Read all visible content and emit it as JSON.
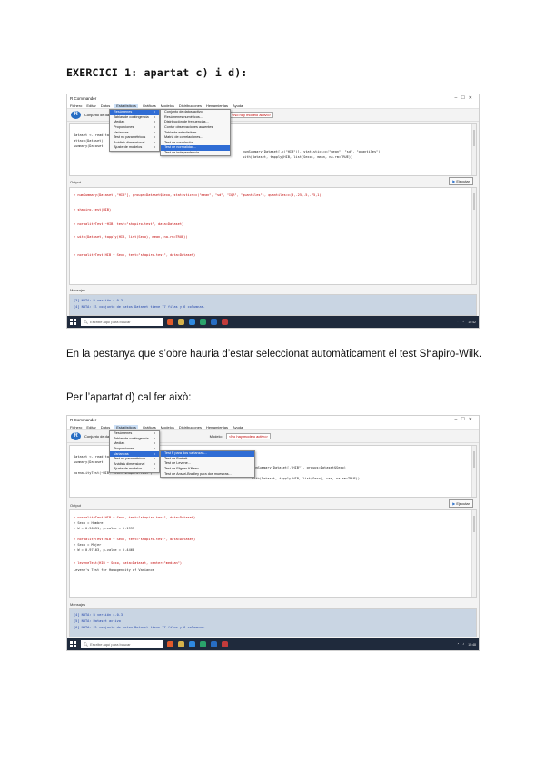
{
  "heading": "EXERCICI 1: apartat c) i d):",
  "para1": "En la pestanya que s’obre hauria d’estar seleccionat automàticament el test Shapiro-Wilk.",
  "para2": "Per l’apartat d) cal fer això:",
  "shot1": {
    "title": "R Commander",
    "menu": [
      "Fichero",
      "Editar",
      "Datos",
      "Estadísticos",
      "Gráficas",
      "Modelos",
      "Distribuciones",
      "Herramientas",
      "Ayuda"
    ],
    "dataset_label": "Conjunto de datos:",
    "dataset_btn": "Editar conjunto de datos",
    "model_label": "Modelo:",
    "model_value": "<No hay modelo activo>",
    "script_lines": [
      "Dataset <- read.table(...)",
      "attach(Dataset)",
      "summary(Dataset)",
      "numSummary(Dataset[,c(\"HIB\")], statistics=c(\"mean\", \"sd\", \"quantiles\"))",
      "with(Dataset, tapply(HIB, list(Sexo), mean, na.rm=TRUE))"
    ],
    "output_label": "Output",
    "submit": "Ejecutar",
    "output_lines": [
      "> numSummary(Dataset[,\"HIB\"], groups=Dataset$Sexo, statistics=c(\"mean\", \"sd\", \"IQR\", \"quantiles\"), quantiles=c(0,.25,.5,.75,1))",
      "> shapiro.test(HIB)",
      "> normalityTest(~HIB, test=\"shapiro.test\", data=Dataset)",
      "> with(Dataset, tapply(HIB, list(Sexo), mean, na.rm=TRUE))",
      "> normalityTest(HIB ~ Sexo, test=\"shapiro.test\", data=Dataset)"
    ],
    "messages_label": "Mensajes",
    "message_lines": [
      "[3] NOTA: R versión 4.0.3",
      "[4] NOTA: El conjunto de datos Dataset tiene 77 filas y 6 columnas."
    ],
    "menu1": [
      "Resúmenes",
      "Tablas de contingencia",
      "Medias",
      "Proporciones",
      "Varianzas",
      "Test no paramétricos",
      "Análisis dimensional",
      "Ajuste de modelos"
    ],
    "menu2": [
      "Conjunto de datos activo",
      "Resúmenes numéricos...",
      "Distribución de frecuencias...",
      "Contar observaciones ausentes",
      "Tabla de estadísticas...",
      "Matriz de correlaciones...",
      "Test de correlación...",
      "Test de normalidad...",
      "Test de independencia..."
    ],
    "menu2_highlight": 7,
    "search_placeholder": "Escribe aquí para buscar",
    "clock": "15:42"
  },
  "shot2": {
    "title": "R Commander",
    "menu": [
      "Fichero",
      "Editar",
      "Datos",
      "Estadísticos",
      "Gráficas",
      "Modelos",
      "Distribuciones",
      "Herramientas",
      "Ayuda"
    ],
    "dataset_label": "Conjunto de datos:",
    "model_label": "Modelo:",
    "model_value": "<No hay modelo activo>",
    "script_lines": [
      "Dataset <- read.table(...)",
      "summary(Dataset)",
      "numSummary(Dataset[,\"HIB\"], groups=Dataset$Sexo)",
      "normalityTest(~HIB, test=\"shapiro.test\")",
      "with(Dataset, tapply(HIB, list(Sexo), var, na.rm=TRUE))"
    ],
    "output_label": "Output",
    "submit": "Ejecutar",
    "output_lines": [
      "> normalityTest(HIB ~ Sexo, test=\"shapiro.test\", data=Dataset)",
      "> Sexo = Hombre",
      "> W = 0.96031, p-value = 0.1995",
      "> normalityTest(HIB ~ Sexo, test=\"shapiro.test\", data=Dataset)",
      "> Sexo = Mujer",
      "> W = 0.97103, p-value = 0.4468",
      "> leveneTest(HIB ~ Sexo, data=Dataset, center=\"median\")",
      "Levene's Test for Homogeneity of Variance"
    ],
    "messages_label": "Mensajes",
    "message_lines": [
      "[4] NOTA: R versión 4.0.3",
      "[5] NOTA: Dataset activo",
      "[6] NOTA: El conjunto de datos Dataset tiene 77 filas y 6 columnas."
    ],
    "menu1": [
      "Resúmenes",
      "Tablas de contingencia",
      "Medias",
      "Proporciones",
      "Varianzas",
      "Test no paramétricos",
      "Análisis dimensional",
      "Ajuste de modelos"
    ],
    "menu1_highlight": 4,
    "menu2": [
      "Test F para dos varianzas...",
      "Test de Bartlett...",
      "Test de Levene...",
      "Test de Fligner-Killeen...",
      "Test de Ansari-Bradley para dos muestras..."
    ],
    "menu2_highlight": 0,
    "search_placeholder": "Escribe aquí para buscar",
    "clock": "15:48"
  }
}
